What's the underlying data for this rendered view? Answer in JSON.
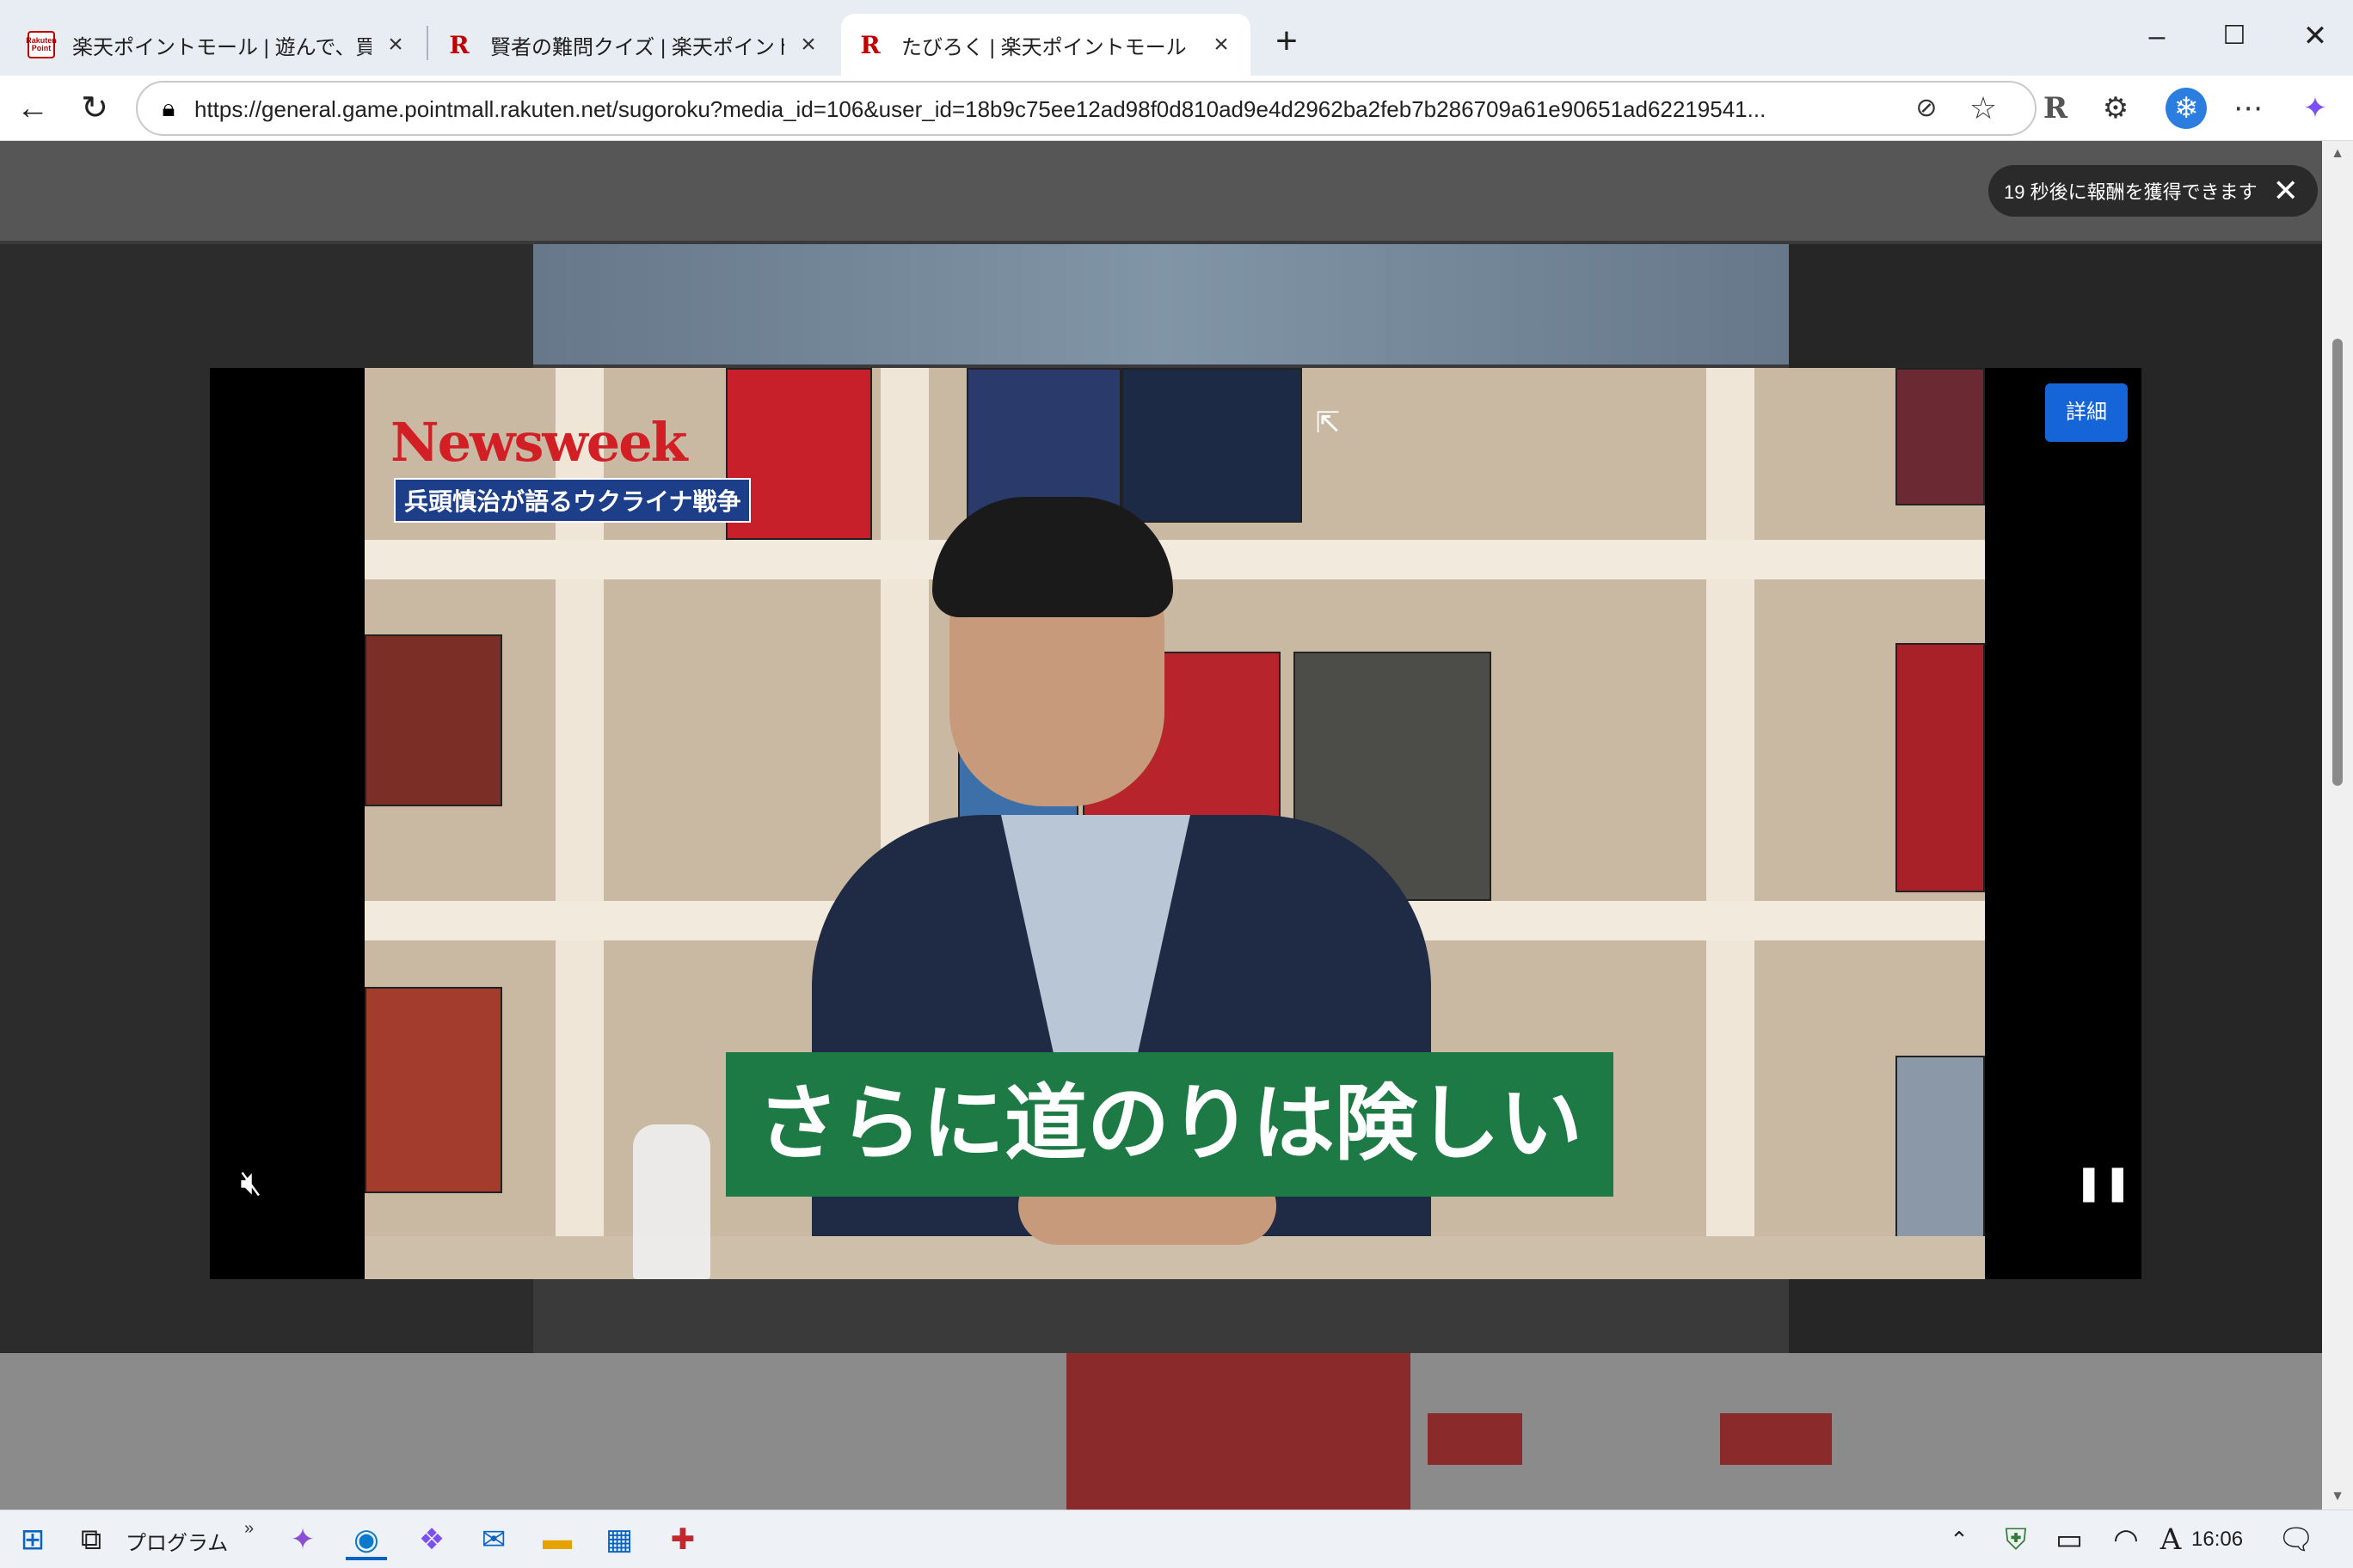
{
  "tabs": [
    {
      "title": "楽天ポイントモール | 遊んで、買って楽",
      "favicon": "rakuten-pointmall-icon",
      "active": false
    },
    {
      "title": "賢者の難問クイズ | 楽天ポイントモール",
      "favicon": "rakuten-r-icon",
      "active": false
    },
    {
      "title": "たびろく | 楽天ポイントモール",
      "favicon": "rakuten-r-icon",
      "active": true
    }
  ],
  "address_bar": {
    "url": "https://general.game.pointmall.rakuten.net/sugoroku?media_id=106&user_id=18b9c75ee12ad98f0d810ad9e4d2962ba2feb7b286709a61e90651ad62219541..."
  },
  "page": {
    "reward_timer_text": "19 秒後に報酬を獲得できます"
  },
  "video": {
    "details_label": "詳細",
    "overlay_logo": "Newsweek",
    "overlay_subtitle": "兵頭慎治が語るウクライナ戦争",
    "caption": "さらに道のりは険しい",
    "progress": 0.003,
    "muted": true,
    "playing": true
  },
  "taskbar": {
    "program_label": "プログラム",
    "clock": "16:06"
  },
  "colors": {
    "caption_bg": "#1e7a45",
    "details_button": "#1565d8",
    "newsweek_red": "#d21f26"
  }
}
